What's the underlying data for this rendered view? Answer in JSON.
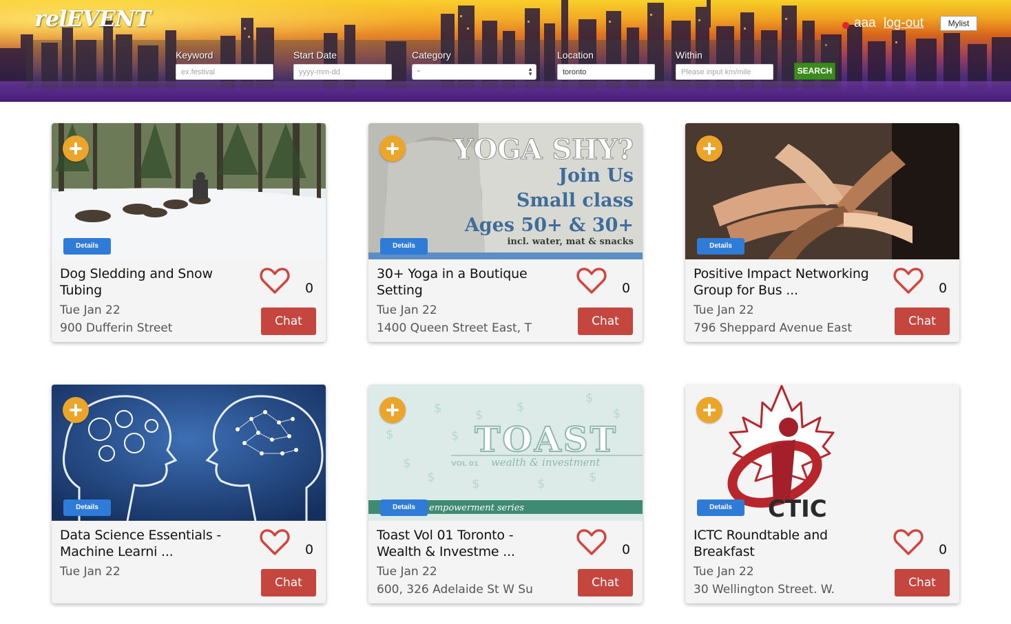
{
  "header": {
    "logo": "relEVENT",
    "user": {
      "name": "aaa",
      "logout_label": "log-out",
      "mylist_label": "Mylist"
    },
    "search": {
      "keyword": {
        "label": "Keyword",
        "placeholder": "ex.festival",
        "value": ""
      },
      "start_date": {
        "label": "Start Date",
        "placeholder": "yyyy-mm-dd",
        "value": ""
      },
      "category": {
        "label": "Category",
        "selected": "-"
      },
      "location": {
        "label": "Location",
        "value": "toronto"
      },
      "within": {
        "label": "Within",
        "placeholder": "Please input km/mile",
        "value": ""
      },
      "button_label": "SEARCH"
    }
  },
  "events": [
    {
      "title": "Dog Sledding and Snow Tubing",
      "date": "Tue Jan 22",
      "address": "900 Dufferin Street",
      "likes": "0",
      "details_label": "Details",
      "chat_label": "Chat",
      "image": "dog-sledding-photo"
    },
    {
      "title": "30+ Yoga in a Boutique Setting",
      "date": "Tue Jan 22",
      "address": "1400 Queen Street East, T",
      "likes": "0",
      "details_label": "Details",
      "chat_label": "Chat",
      "image": "yoga-poster",
      "image_text": {
        "line1": "YOGA SHY?",
        "line2": "Join Us",
        "line3": "Small class",
        "line4": "Ages 50+ & 30+",
        "line5": "incl. water, mat & snacks"
      }
    },
    {
      "title": "Positive Impact Networking Group for Bus ...",
      "date": "Tue Jan 22",
      "address": "796 Sheppard Avenue East",
      "likes": "0",
      "details_label": "Details",
      "chat_label": "Chat",
      "image": "stacked-hands-photo"
    },
    {
      "title": "Data Science Essentials - Machine Learni ...",
      "date": "Tue Jan 22",
      "address": "",
      "likes": "0",
      "details_label": "Details",
      "chat_label": "Chat",
      "image": "brain-network-illustration"
    },
    {
      "title": "Toast Vol 01 Toronto - Wealth & Investme ...",
      "date": "Tue Jan 22",
      "address": "600, 326 Adelaide St W Su",
      "likes": "0",
      "details_label": "Details",
      "chat_label": "Chat",
      "image": "toast-poster",
      "image_text": {
        "word": "TOAST",
        "vol": "VOL 01",
        "sub": "wealth & investment",
        "series": "empowerment series"
      }
    },
    {
      "title": "ICTC Roundtable and Breakfast",
      "date": "Tue Jan 22",
      "address": "30 Wellington Street. W.",
      "likes": "0",
      "details_label": "Details",
      "chat_label": "Chat",
      "image": "ictc-logo",
      "image_text": {
        "logo": "CTIC"
      }
    }
  ],
  "colors": {
    "chat": "#c4463f",
    "details": "#2f7bd8",
    "add": "#eba52a",
    "heart": "#d2443c",
    "search": "#3a8a1e"
  }
}
